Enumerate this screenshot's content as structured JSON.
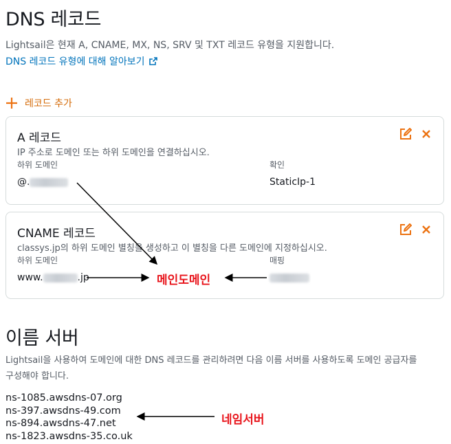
{
  "dns": {
    "heading": "DNS 레코드",
    "description": "Lightsail은 현재 A, CNAME, MX, NS, SRV 및 TXT 레코드 유형을 지원합니다.",
    "learn_more_link": "DNS 레코드 유형에 대해 알아보기",
    "add_record_label": "레코드 추가"
  },
  "records": [
    {
      "title": "A 레코드",
      "subtitle": "IP 주소로 도메인 또는 하위 도메인을 연결하십시오.",
      "col1_label": "하위 도메인",
      "col1_value": "@.",
      "col2_label": "확인",
      "col2_value": "StaticIp-1"
    },
    {
      "title": "CNAME 레코드",
      "subtitle": "classys.jp의 하위 도메인 별칭을 생성하고 이 별칭을 다른 도메인에 지정하십시오.",
      "col1_label": "하위 도메인",
      "col1_value": "www.",
      "col1_suffix": ".jp",
      "col2_label": "매핑",
      "col2_value": ""
    }
  ],
  "annotations": {
    "main_domain": "메인도메인",
    "nameserver": "네임서버"
  },
  "nameservers": {
    "heading": "이름 서버",
    "description": "Lightsail을 사용하여 도메인에 대한 DNS 레코드를 관리하려면 다음 이름 서버를 사용하도록 도메인 공급자를 구성해야 합니다.",
    "list": [
      "ns-1085.awsdns-07.org",
      "ns-397.awsdns-49.com",
      "ns-894.awsdns-47.net",
      "ns-1823.awsdns-35.co.uk"
    ]
  },
  "colors": {
    "accent_orange": "#ec7211",
    "link_blue": "#0073bb",
    "annotation_red": "#e8141b"
  }
}
